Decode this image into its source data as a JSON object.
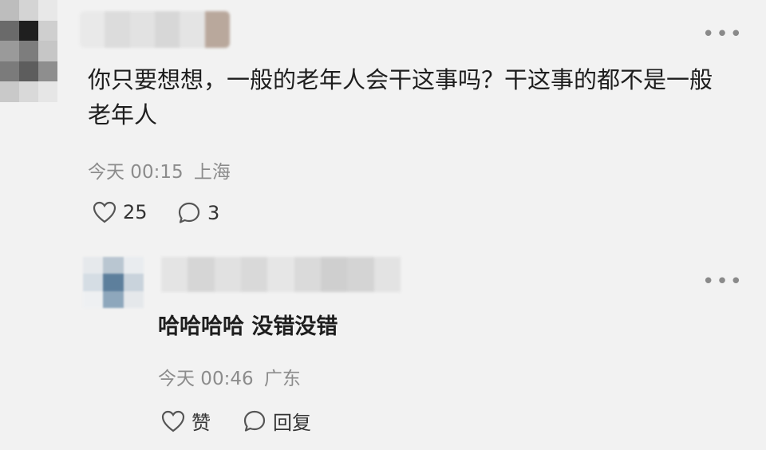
{
  "comment": {
    "text": "你只要想想，一般的老年人会干这事吗？干这事的都不是一般老年人",
    "time": "今天 00:15",
    "location": "上海",
    "likes": "25",
    "replies": "3",
    "more_icon": "ellipsis-icon"
  },
  "reply": {
    "text": "哈哈哈哈 没错没错",
    "time": "今天 00:46",
    "location": "广东",
    "like_label": "赞",
    "reply_label": "回复",
    "more_icon": "ellipsis-icon"
  },
  "colors": {
    "background": "#f2f2f2",
    "meta_text": "#8c8c8c",
    "body_text": "#1e1e1e"
  }
}
